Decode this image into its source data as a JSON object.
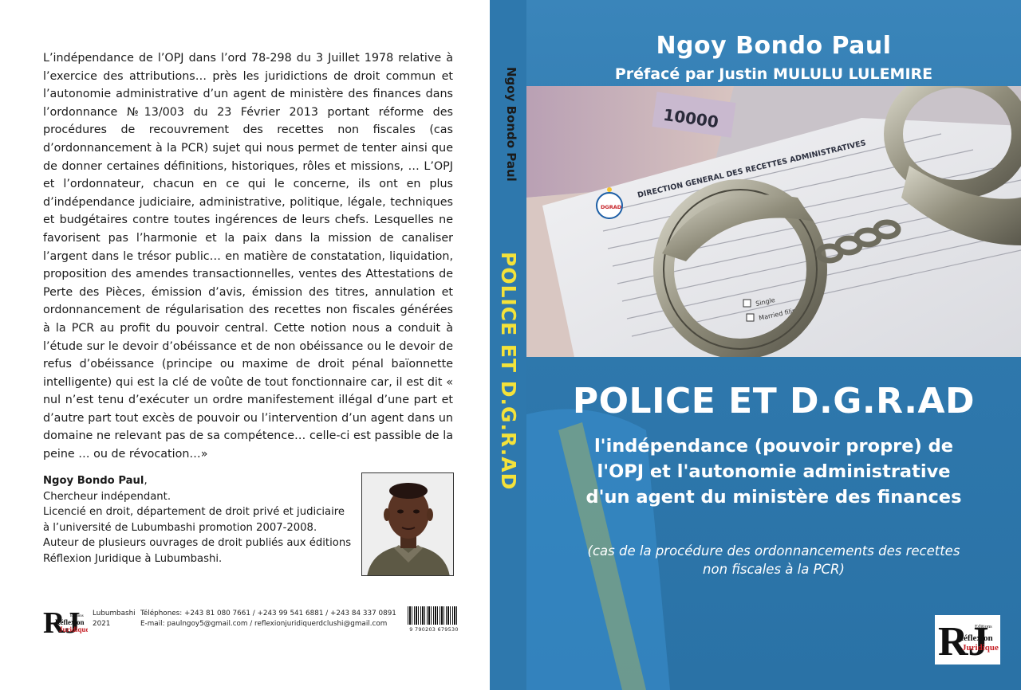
{
  "back_cover": {
    "paragraph": "L’indépendance de l’OPJ dans l’ord 78-298 du 3 Juillet 1978 relative à l’exercice des attributions… près les juridictions de droit commun et l’autonomie administrative d’un agent de ministère des finances dans l’ordonnance №13/003 du 23 Février 2013 portant réforme des procédures de recouvrement des recettes non fiscales (cas d’ordonnancement à la PCR) sujet qui nous permet de tenter ainsi que de donner certaines définitions, historiques, rôles et missions, … L’OPJ et l’ordonnateur, chacun en ce qui le concerne, ils ont en plus d’indépendance judiciaire, administrative, politique, légale, techniques et budgétaires contre toutes ingérences de leurs chefs. Lesquelles ne favorisent pas l’harmonie et la paix dans la mission de canaliser l’argent dans le trésor public… en matière de constatation, liquidation, proposition des amendes transactionnelles, ventes des Attestations de Perte des Pièces, émission d’avis, émission des titres, annulation et ordonnancement de régularisation des recettes non fiscales générées à la PCR au profit du pouvoir central. Cette notion nous a conduit à l’étude sur le devoir d’obéissance et de non obéissance ou le devoir de refus d’obéissance (principe ou maxime de droit pénal baïonnette intelligente) qui est la clé de voûte de tout fonctionnaire car, il est dit « nul n’est tenu d’exécuter un ordre manifestement illégal d’une part et d’autre part tout excès de pouvoir ou l’intervention d’un agent dans un domaine ne relevant pas de sa compétence… celle-ci est passible de la peine … ou de révocation…»",
    "author_name": "Ngoy Bondo Paul",
    "author_comma": ",",
    "author_role": "Chercheur indépendant.",
    "author_bio_1": "Licencié en droit, département de droit privé et judiciaire à l’université de Lubumbashi promotion 2007-2008.",
    "author_bio_2": "Auteur de plusieurs ouvrages de droit publiés aux éditions Réflexion Juridique à Lubumbashi.",
    "footer_city": "Lubumbashi",
    "footer_year": "2021",
    "footer_phones": "Téléphones: +243 81 080 7661 / +243 99 541 6881 / +243  84 337 0891",
    "footer_email": "E-mail: paulngoy5@gmail.com / reflexionjuridiquerdclushi@gmail.com",
    "barcode_number": "9 790203 679530"
  },
  "spine": {
    "author": "Ngoy Bondo Paul",
    "title": "POLICE ET D.G.R.AD"
  },
  "front_cover": {
    "author": "Ngoy Bondo Paul",
    "preface": "Préfacé par  Justin MULULU LULEMIRE",
    "title": "POLICE ET D.G.R.AD",
    "subtitle_1": "l'indépendance (pouvoir propre) de",
    "subtitle_2": "l'OPJ et l'autonomie administrative",
    "subtitle_3": "d'un agent du ministère des finances",
    "note_1": "(cas de la procédure des ordonnancements des recettes",
    "note_2": "non fiscales à la PCR)"
  },
  "image_text": {
    "form_header": "DIRECTION GENERAL DES RECETTES ADMINISTRATIVES",
    "banknote": "10000",
    "dgrad_badge": "DGRAD",
    "opt_single": "Single",
    "opt_married": "Married filing"
  },
  "logo": {
    "letters": "RJ",
    "label_1": "Editions",
    "label_2": "Réflexion",
    "label_3": "Juridique"
  }
}
